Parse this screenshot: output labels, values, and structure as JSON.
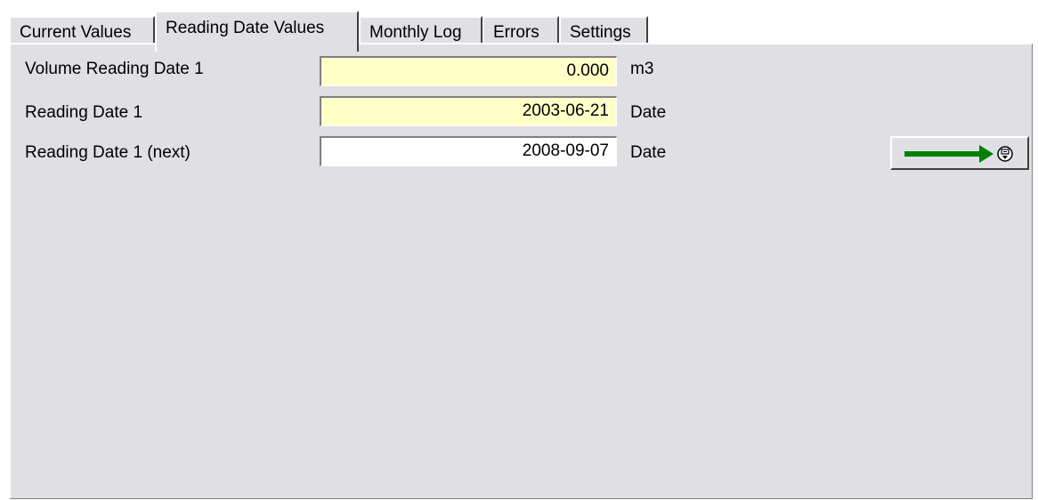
{
  "tabs": [
    {
      "label": "Current Values",
      "active": false
    },
    {
      "label": "Reading Date Values",
      "active": true
    },
    {
      "label": "Monthly Log",
      "active": false
    },
    {
      "label": "Errors",
      "active": false
    },
    {
      "label": "Settings",
      "active": false
    }
  ],
  "rows": [
    {
      "label": "Volume Reading Date 1",
      "value": "0.000",
      "unit": "m3",
      "field_color": "#ffffc8"
    },
    {
      "label": "Reading Date 1",
      "value": "2003-06-21",
      "unit": "Date",
      "field_color": "#ffffc8"
    },
    {
      "label": "Reading Date 1 (next)",
      "value": "2008-09-07",
      "unit": "Date",
      "field_color": "#ffffff"
    }
  ],
  "action_button": {
    "icon": "green-arrow-write-icon",
    "arrow_color": "#008000"
  }
}
